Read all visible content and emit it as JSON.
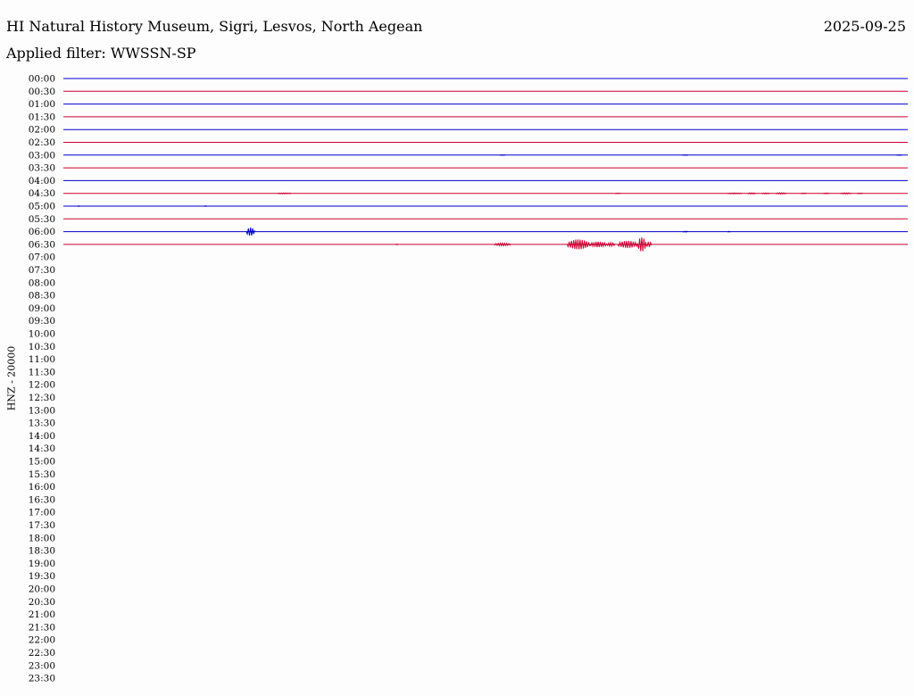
{
  "header": {
    "title": "HI Natural History Museum, Sigri, Lesvos, North Aegean",
    "date": "2025-09-25",
    "filter_label": "Applied filter: WWSSN-SP"
  },
  "chart_data": {
    "type": "line",
    "title": "HI Natural History Museum, Sigri, Lesvos, North Aegean",
    "subtitle": "Applied filter: WWSSN-SP",
    "ylabel": "HNZ - 20000",
    "xlabel": "",
    "date": "2025-09-25",
    "grid": false,
    "row_colors": [
      "#0000cc",
      "#cc0033"
    ],
    "rows": [
      "00:00",
      "00:30",
      "01:00",
      "01:30",
      "02:00",
      "02:30",
      "03:00",
      "03:30",
      "04:00",
      "04:30",
      "05:00",
      "05:30",
      "06:00",
      "06:30",
      "07:00",
      "07:30",
      "08:00",
      "08:30",
      "09:00",
      "09:30",
      "10:00",
      "10:30",
      "11:00",
      "11:30",
      "12:00",
      "12:30",
      "13:00",
      "13:30",
      "14:00",
      "14:30",
      "15:00",
      "15:30",
      "16:00",
      "16:30",
      "17:00",
      "17:30",
      "18:00",
      "18:30",
      "19:00",
      "19:30",
      "20:00",
      "20:30",
      "21:00",
      "21:30",
      "22:00",
      "22:30",
      "23:00",
      "23:30"
    ],
    "recorded_rows": 14,
    "row_minutes": 30,
    "events": [
      {
        "row": 6,
        "start_min": 15.5,
        "duration_min": 0.2,
        "amplitude": 0.3
      },
      {
        "row": 6,
        "start_min": 22.0,
        "duration_min": 0.2,
        "amplitude": 0.3
      },
      {
        "row": 6,
        "start_min": 29.6,
        "duration_min": 0.2,
        "amplitude": 0.3
      },
      {
        "row": 9,
        "start_min": 7.6,
        "duration_min": 0.5,
        "amplitude": 0.5
      },
      {
        "row": 9,
        "start_min": 19.6,
        "duration_min": 0.2,
        "amplitude": 0.3
      },
      {
        "row": 9,
        "start_min": 23.6,
        "duration_min": 0.5,
        "amplitude": 0.5
      },
      {
        "row": 9,
        "start_min": 24.3,
        "duration_min": 0.3,
        "amplitude": 0.6
      },
      {
        "row": 9,
        "start_min": 24.8,
        "duration_min": 0.3,
        "amplitude": 0.5
      },
      {
        "row": 9,
        "start_min": 25.3,
        "duration_min": 0.4,
        "amplitude": 0.7
      },
      {
        "row": 9,
        "start_min": 26.2,
        "duration_min": 0.2,
        "amplitude": 0.4
      },
      {
        "row": 9,
        "start_min": 27.0,
        "duration_min": 0.2,
        "amplitude": 0.5
      },
      {
        "row": 9,
        "start_min": 27.6,
        "duration_min": 0.4,
        "amplitude": 0.6
      },
      {
        "row": 9,
        "start_min": 28.2,
        "duration_min": 0.2,
        "amplitude": 0.4
      },
      {
        "row": 10,
        "start_min": 0.5,
        "duration_min": 0.1,
        "amplitude": 0.4
      },
      {
        "row": 10,
        "start_min": 5.0,
        "duration_min": 0.1,
        "amplitude": 0.4
      },
      {
        "row": 12,
        "start_min": 6.5,
        "duration_min": 0.3,
        "amplitude": 4.5
      },
      {
        "row": 12,
        "start_min": 22.0,
        "duration_min": 0.2,
        "amplitude": 0.5
      },
      {
        "row": 12,
        "start_min": 23.6,
        "duration_min": 0.1,
        "amplitude": 0.4
      },
      {
        "row": 13,
        "start_min": 11.8,
        "duration_min": 0.1,
        "amplitude": 0.4
      },
      {
        "row": 13,
        "start_min": 15.3,
        "duration_min": 0.6,
        "amplitude": 1.5
      },
      {
        "row": 13,
        "start_min": 17.9,
        "duration_min": 0.8,
        "amplitude": 5.5
      },
      {
        "row": 13,
        "start_min": 18.7,
        "duration_min": 0.6,
        "amplitude": 3.0
      },
      {
        "row": 13,
        "start_min": 19.3,
        "duration_min": 0.3,
        "amplitude": 2.0
      },
      {
        "row": 13,
        "start_min": 19.7,
        "duration_min": 0.7,
        "amplitude": 4.0
      },
      {
        "row": 13,
        "start_min": 20.4,
        "duration_min": 0.3,
        "amplitude": 8.0
      },
      {
        "row": 13,
        "start_min": 20.7,
        "duration_min": 0.2,
        "amplitude": 3.0
      }
    ]
  }
}
